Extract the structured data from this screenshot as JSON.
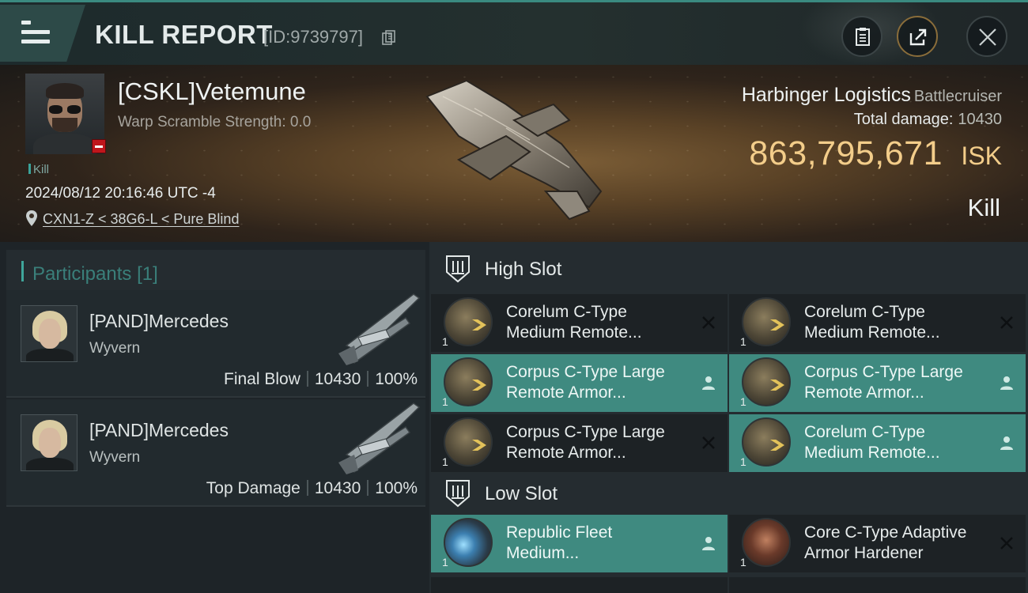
{
  "header": {
    "title": "KILL REPORT",
    "report_id": "[ID:9739797]",
    "icons": [
      "menu-icon",
      "copy-icon",
      "clipboard-icon",
      "share-icon",
      "close-icon"
    ]
  },
  "victim": {
    "name": "[CSKL]Vetemune",
    "warp_scramble": "Warp Scramble Strength: 0.0",
    "tag": "Kill",
    "time": "2024/08/12 20:16:46 UTC -4",
    "location": "CXN1-Z < 38G6-L < Pure Blind",
    "ship": "Harbinger Logistics",
    "ship_class": "Battlecruiser",
    "total_damage_label": "Total damage:",
    "total_damage": "10430",
    "isk_value": "863,795,671",
    "isk_unit": "ISK",
    "type": "Kill"
  },
  "participants": {
    "title": "Participants",
    "count": "[1]",
    "list": [
      {
        "name": "[PAND]Mercedes",
        "ship": "Wyvern",
        "role": "Final Blow",
        "damage": "10430",
        "percent": "100%"
      },
      {
        "name": "[PAND]Mercedes",
        "ship": "Wyvern",
        "role": "Top Damage",
        "damage": "10430",
        "percent": "100%"
      }
    ]
  },
  "high_slot": {
    "title": "High Slot",
    "modules": [
      {
        "line1": "Corelum C-Type",
        "line2": "Medium Remote...",
        "qty": "1",
        "status": "destroyed"
      },
      {
        "line1": "Corelum C-Type",
        "line2": "Medium Remote...",
        "qty": "1",
        "status": "destroyed"
      },
      {
        "line1": "Corpus C-Type Large",
        "line2": "Remote Armor...",
        "qty": "1",
        "status": "dropped"
      },
      {
        "line1": "Corpus C-Type Large",
        "line2": "Remote Armor...",
        "qty": "1",
        "status": "dropped"
      },
      {
        "line1": "Corpus C-Type Large",
        "line2": "Remote Armor...",
        "qty": "1",
        "status": "destroyed"
      },
      {
        "line1": "Corelum C-Type",
        "line2": "Medium Remote...",
        "qty": "1",
        "status": "dropped"
      }
    ]
  },
  "low_slot": {
    "title": "Low Slot",
    "modules": [
      {
        "line1": "Republic Fleet",
        "line2": "Medium...",
        "qty": "1",
        "status": "dropped"
      },
      {
        "line1": "Core C-Type Adaptive",
        "line2": "Armor Hardener",
        "qty": "1",
        "status": "destroyed"
      }
    ]
  },
  "colors": {
    "accent": "#3f8a80",
    "isk": "#f3cd8a",
    "background": "#252c30"
  }
}
